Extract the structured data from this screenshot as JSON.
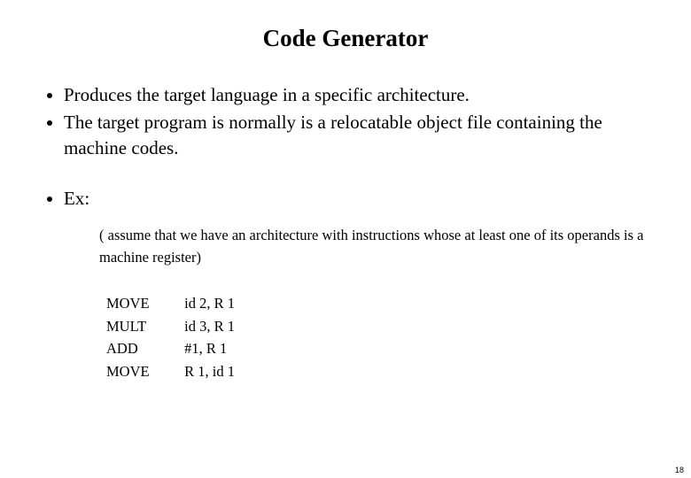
{
  "title": "Code Generator",
  "bullets": {
    "b1": "Produces the target language in a specific architecture.",
    "b2": "The target program is normally is a relocatable object file containing the machine codes.",
    "b3": "Ex:"
  },
  "note": "( assume that we have an architecture with instructions whose at least one of its operands is a machine register)",
  "code": {
    "r0": {
      "op": "MOVE",
      "args": "id 2, R 1"
    },
    "r1": {
      "op": "MULT",
      "args": "id 3, R 1"
    },
    "r2": {
      "op": "ADD",
      "args": "#1, R 1"
    },
    "r3": {
      "op": "MOVE",
      "args": "R 1, id 1"
    }
  },
  "page": "18"
}
